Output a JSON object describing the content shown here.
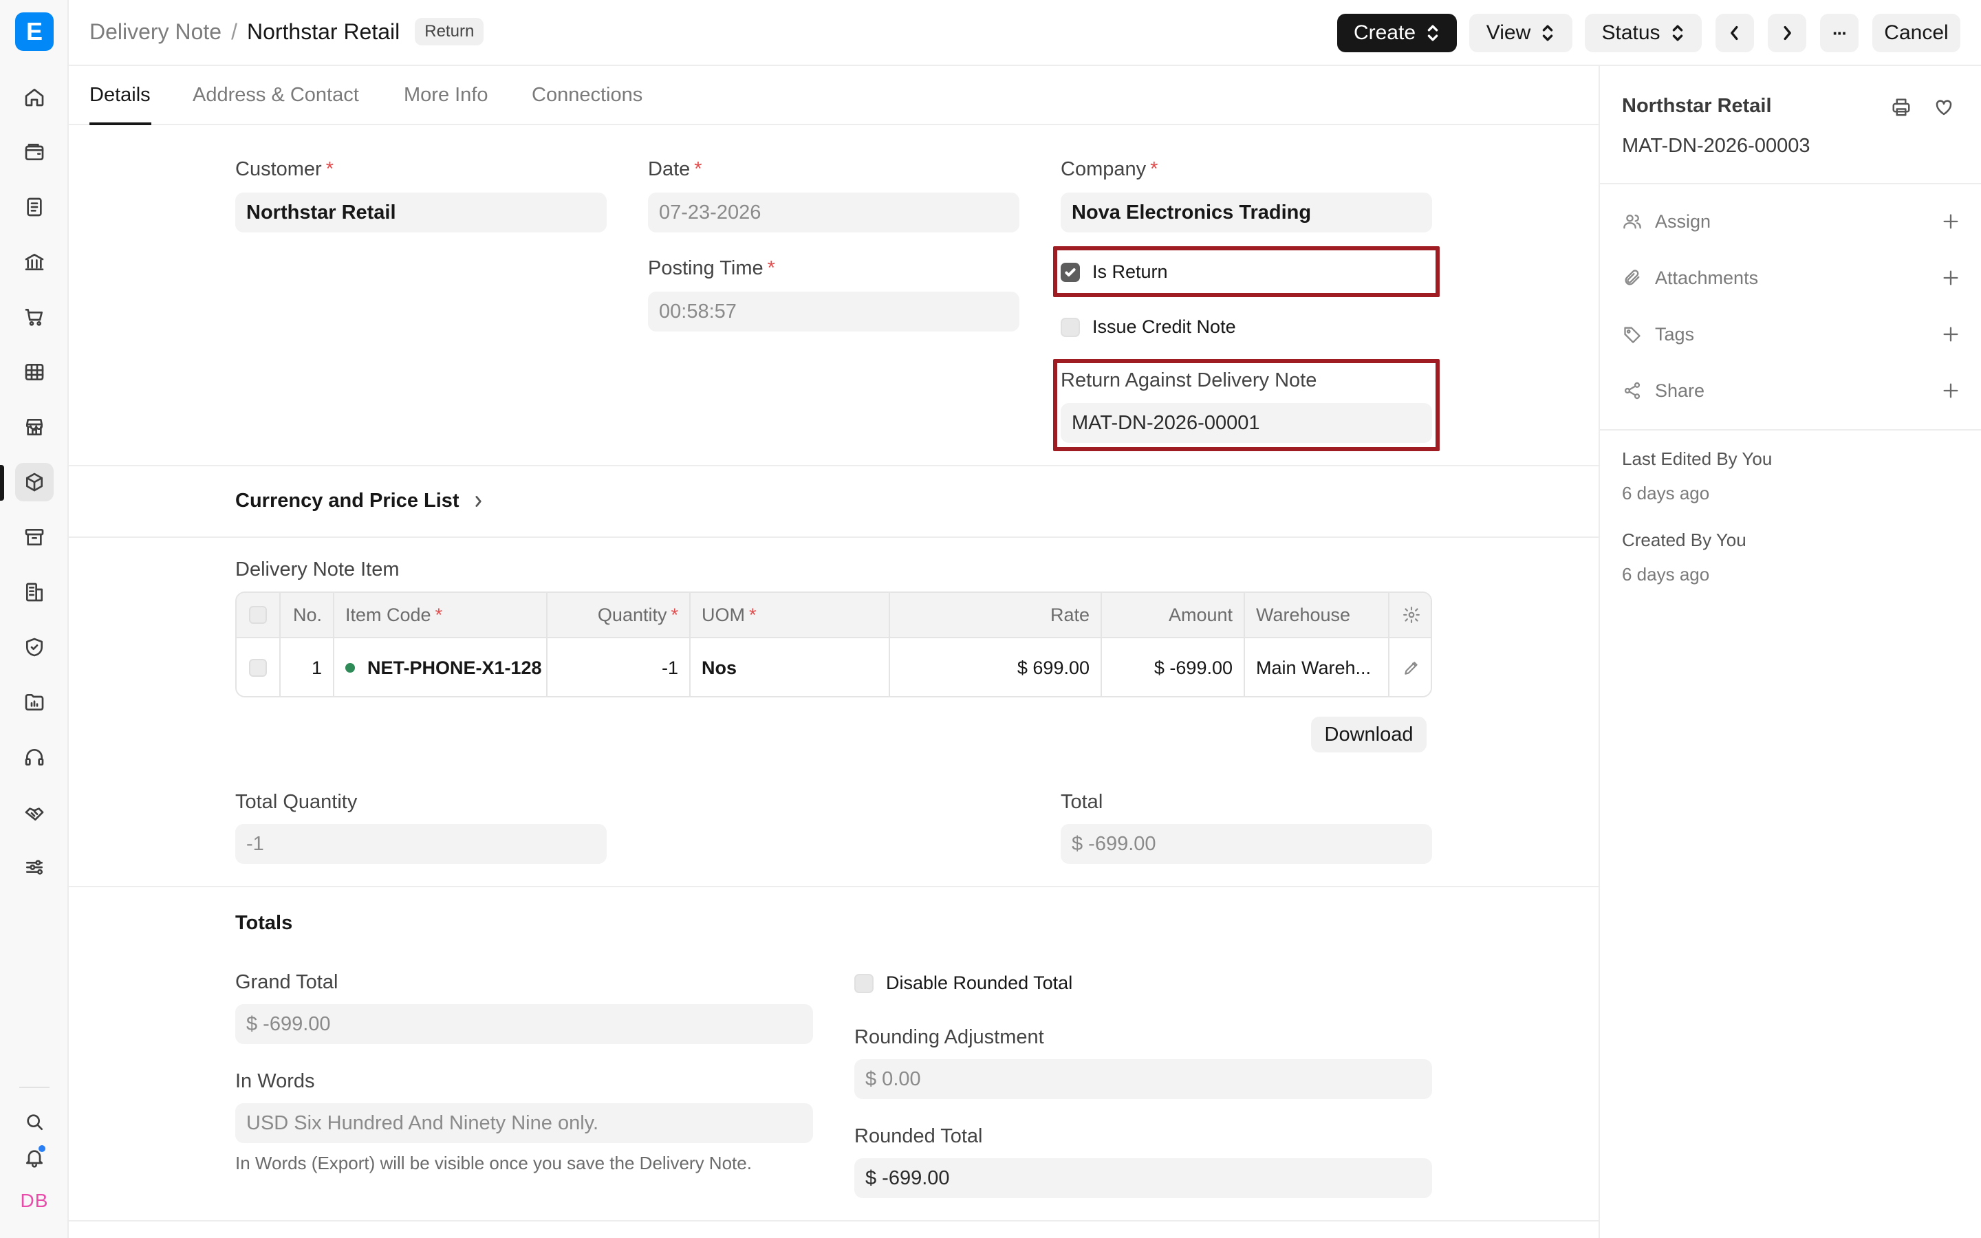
{
  "app": {
    "logo_letter": "E",
    "user_initials": "DB",
    "accent": "#0289f7",
    "highlight_color": "#9e1c22"
  },
  "breadcrumb": {
    "parent": "Delivery Note",
    "separator": "/",
    "current": "Northstar Retail",
    "badge": "Return"
  },
  "toolbar": {
    "create": "Create",
    "view": "View",
    "status": "Status",
    "cancel": "Cancel",
    "more": "···"
  },
  "tabs": [
    {
      "label": "Details",
      "active": true
    },
    {
      "label": "Address & Contact",
      "active": false
    },
    {
      "label": "More Info",
      "active": false
    },
    {
      "label": "Connections",
      "active": false
    }
  ],
  "form": {
    "customer": {
      "label": "Customer",
      "value": "Northstar Retail",
      "required": "*"
    },
    "date": {
      "label": "Date",
      "value": "07-23-2026",
      "required": "*"
    },
    "posting_time": {
      "label": "Posting Time",
      "value": "00:58:57",
      "required": "*"
    },
    "company": {
      "label": "Company",
      "value": "Nova Electronics Trading",
      "required": "*"
    },
    "is_return": {
      "label": "Is Return",
      "checked": true
    },
    "issue_credit_note": {
      "label": "Issue Credit Note",
      "checked": false
    },
    "return_against": {
      "label": "Return Against Delivery Note",
      "value": "MAT-DN-2026-00001"
    }
  },
  "sections": {
    "currency": "Currency and Price List",
    "items_title": "Delivery Note Item",
    "totals": "Totals"
  },
  "items_table": {
    "columns": [
      "No.",
      "Item Code",
      "Quantity",
      "UOM",
      "Rate",
      "Amount",
      "Warehouse"
    ],
    "required_mark": "*",
    "rows": [
      {
        "no": "1",
        "item_code": "NET-PHONE-X1-128",
        "quantity": "-1",
        "uom": "Nos",
        "rate": "$ 699.00",
        "amount": "$ -699.00",
        "warehouse": "Main Wareh..."
      }
    ],
    "download": "Download"
  },
  "summary": {
    "total_quantity": {
      "label": "Total Quantity",
      "value": "-1"
    },
    "total": {
      "label": "Total",
      "value": "$ -699.00"
    }
  },
  "totals": {
    "grand_total": {
      "label": "Grand Total",
      "value": "$ -699.00"
    },
    "in_words": {
      "label": "In Words",
      "value": "USD Six Hundred And Ninety Nine only.",
      "note": "In Words (Export) will be visible once you save the Delivery Note."
    },
    "disable_rounded_total": {
      "label": "Disable Rounded Total",
      "checked": false
    },
    "rounding_adjustment": {
      "label": "Rounding Adjustment",
      "value": "$ 0.00"
    },
    "rounded_total": {
      "label": "Rounded Total",
      "value": "$ -699.00"
    }
  },
  "sidebar": {
    "title": "Northstar Retail",
    "doc_id": "MAT-DN-2026-00003",
    "actions": [
      {
        "label": "Assign",
        "icon": "users-icon"
      },
      {
        "label": "Attachments",
        "icon": "paperclip-icon"
      },
      {
        "label": "Tags",
        "icon": "tag-icon"
      },
      {
        "label": "Share",
        "icon": "share-icon"
      }
    ],
    "last_edited": "Last Edited By You",
    "last_edited_ago": "6 days ago",
    "created": "Created By You",
    "created_ago": "6 days ago"
  }
}
